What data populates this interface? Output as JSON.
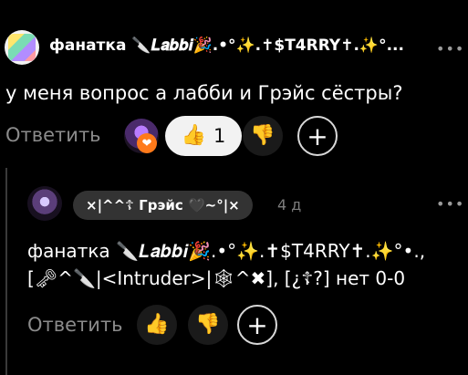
{
  "post": {
    "author": "фанатка 🔪𝑳𝒂𝒃𝒃𝒊🎉.•°✨.✝$T4RRY✝.✨°...",
    "more_icon": "more-dots-icon",
    "question": "у меня вопрос а лабби и Грэйс сёстры?",
    "reply_label": "Ответить",
    "like_count": "1",
    "like_icon": "👍",
    "dislike_icon": "👎",
    "reaction_heart_icon": "❤",
    "plus_label": "+"
  },
  "reply": {
    "author": "×|^^☦ Грэйс 🖤~°|×",
    "time": "4 д",
    "more_icon": "more-dots-icon",
    "text_line1": "фанатка 🔪𝑳𝒂𝒃𝒃𝒊🎉.•°✨.✝$T4RRY✝.✨°•.,",
    "text_line2": "[🗝^🔪|<Intruder>|🕸^✖], [¿☦?] нет 0-0",
    "reply_label": "Ответить",
    "like_icon": "👍",
    "dislike_icon": "👎",
    "plus_label": "+"
  }
}
